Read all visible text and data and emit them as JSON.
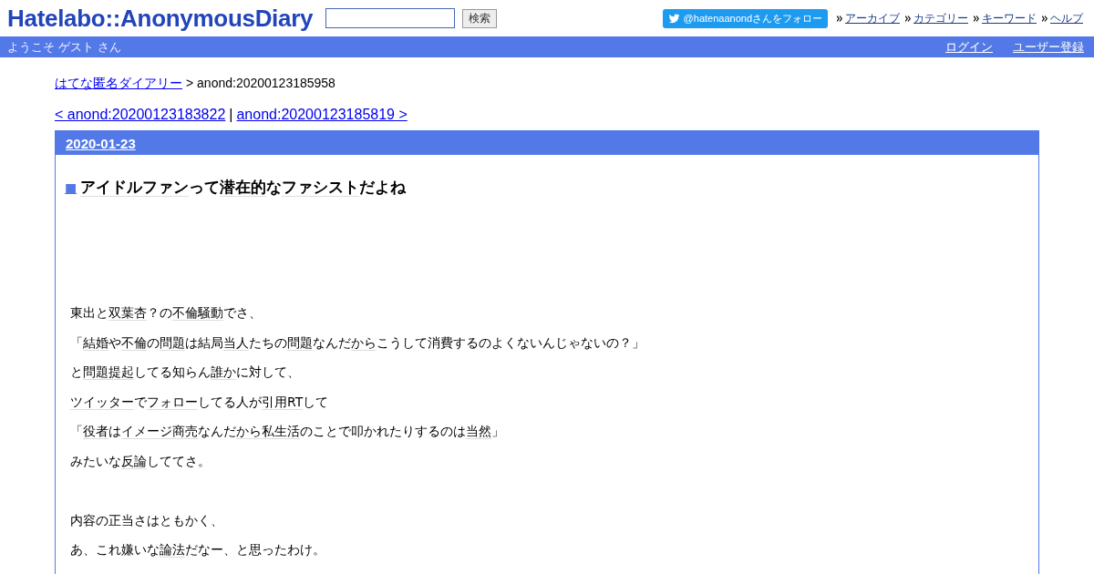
{
  "header": {
    "logo": "Hatelabo::AnonymousDiary",
    "search": {
      "button": "検索"
    },
    "twitter_follow": "@hatenaanondさんをフォロー",
    "nav_links": [
      "アーカイブ",
      "カテゴリー",
      "キーワード",
      "ヘルプ"
    ]
  },
  "user_bar": {
    "welcome": "ようこそ ゲスト さん",
    "links": [
      "ログイン",
      "ユーザー登録"
    ]
  },
  "breadcrumb": {
    "link": "はてな匿名ダイアリー",
    "current": "> anond:20200123185958"
  },
  "pager": {
    "prev": "< anond:20200123183822",
    "separator": "|",
    "next": "anond:20200123185819 >"
  },
  "day": {
    "date": "2020-01-23",
    "entry": {
      "marker": "■",
      "title": [
        {
          "text": "アイドルファン",
          "keyword": true
        },
        {
          "text": "って",
          "keyword": false
        },
        {
          "text": "潜在的",
          "keyword": true
        },
        {
          "text": "な",
          "keyword": false
        },
        {
          "text": "ファシスト",
          "keyword": true
        },
        {
          "text": "だよね",
          "keyword": false
        }
      ],
      "paragraphs": [
        {
          "gap_before": false,
          "segments": [
            {
              "text": "東出と",
              "keyword": false
            },
            {
              "text": "双葉杏",
              "keyword": true
            },
            {
              "text": "？の",
              "keyword": false
            },
            {
              "text": "不倫騒動",
              "keyword": true
            },
            {
              "text": "でさ、",
              "keyword": false
            }
          ]
        },
        {
          "gap_before": false,
          "segments": [
            {
              "text": "「",
              "keyword": false
            },
            {
              "text": "結婚",
              "keyword": true
            },
            {
              "text": "や",
              "keyword": false
            },
            {
              "text": "不倫",
              "keyword": true
            },
            {
              "text": "の",
              "keyword": false
            },
            {
              "text": "問題",
              "keyword": true
            },
            {
              "text": "は結局",
              "keyword": false
            },
            {
              "text": "当人",
              "keyword": true
            },
            {
              "text": "たちの",
              "keyword": false
            },
            {
              "text": "問題",
              "keyword": true
            },
            {
              "text": "なんだ",
              "keyword": false
            },
            {
              "text": "から",
              "keyword": true
            },
            {
              "text": "こうして消費するのよくないんじゃないの？」",
              "keyword": false
            }
          ]
        },
        {
          "gap_before": false,
          "segments": [
            {
              "text": "と",
              "keyword": false
            },
            {
              "text": "問題提起",
              "keyword": true
            },
            {
              "text": "してる知らん",
              "keyword": false
            },
            {
              "text": "誰か",
              "keyword": true
            },
            {
              "text": "に対して、",
              "keyword": false
            }
          ]
        },
        {
          "gap_before": false,
          "segments": [
            {
              "text": "ツイッター",
              "keyword": true
            },
            {
              "text": "で",
              "keyword": false
            },
            {
              "text": "フォロー",
              "keyword": true
            },
            {
              "text": "してる人が",
              "keyword": false
            },
            {
              "text": "引用RT",
              "keyword": true
            },
            {
              "text": "して",
              "keyword": false
            }
          ]
        },
        {
          "gap_before": false,
          "segments": [
            {
              "text": "「",
              "keyword": false
            },
            {
              "text": "役者",
              "keyword": true
            },
            {
              "text": "は",
              "keyword": false
            },
            {
              "text": "イメージ商売",
              "keyword": true
            },
            {
              "text": "なんだ",
              "keyword": false
            },
            {
              "text": "から",
              "keyword": true
            },
            {
              "text": "私生活",
              "keyword": true
            },
            {
              "text": "のことで叩かれたりするのは",
              "keyword": false
            },
            {
              "text": "当然",
              "keyword": true
            },
            {
              "text": "」",
              "keyword": false
            }
          ]
        },
        {
          "gap_before": false,
          "segments": [
            {
              "text": "みたいな",
              "keyword": false
            },
            {
              "text": "反論",
              "keyword": true
            },
            {
              "text": "しててさ。",
              "keyword": false
            }
          ]
        },
        {
          "gap_before": true,
          "segments": [
            {
              "text": "内容の正当さはともかく、",
              "keyword": false
            }
          ]
        },
        {
          "gap_before": false,
          "segments": [
            {
              "text": "あ、これ嫌いな",
              "keyword": false
            },
            {
              "text": "論法",
              "keyword": true
            },
            {
              "text": "だなー、と思ったわけ。",
              "keyword": false
            }
          ]
        }
      ]
    }
  }
}
